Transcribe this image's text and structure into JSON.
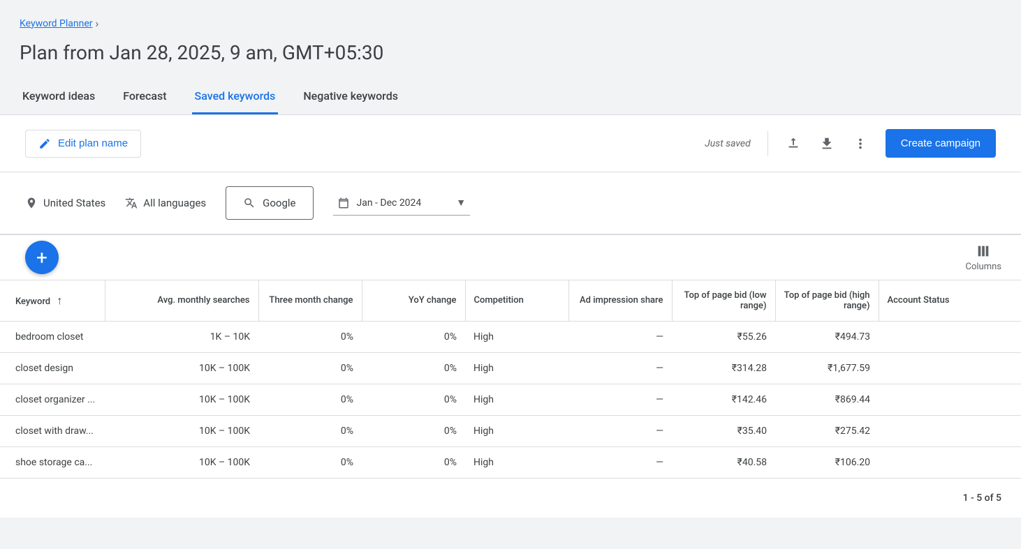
{
  "breadcrumb": {
    "parent": "Keyword Planner"
  },
  "page_title": "Plan from Jan 28, 2025, 9 am, GMT+05:30",
  "tabs": {
    "keyword_ideas": "Keyword ideas",
    "forecast": "Forecast",
    "saved_keywords": "Saved keywords",
    "negative_keywords": "Negative keywords"
  },
  "toolbar": {
    "edit_label": "Edit plan name",
    "saved_status": "Just saved",
    "create_campaign": "Create campaign"
  },
  "filters": {
    "location": "United States",
    "language": "All languages",
    "network": "Google",
    "date_range": "Jan - Dec 2024"
  },
  "columns_label": "Columns",
  "headers": {
    "keyword": "Keyword",
    "searches": "Avg. monthly searches",
    "three_month": "Three month change",
    "yoy": "YoY change",
    "competition": "Competition",
    "impression": "Ad impression share",
    "bid_low": "Top of page bid (low range)",
    "bid_high": "Top of page bid (high range)",
    "status": "Account Status"
  },
  "rows": [
    {
      "keyword": "bedroom closet",
      "searches": "1K – 10K",
      "tmc": "0%",
      "yoy": "0%",
      "comp": "High",
      "imp": "—",
      "low": "₹55.26",
      "high": "₹494.73",
      "status": ""
    },
    {
      "keyword": "closet design",
      "searches": "10K – 100K",
      "tmc": "0%",
      "yoy": "0%",
      "comp": "High",
      "imp": "—",
      "low": "₹314.28",
      "high": "₹1,677.59",
      "status": ""
    },
    {
      "keyword": "closet organizer ...",
      "searches": "10K – 100K",
      "tmc": "0%",
      "yoy": "0%",
      "comp": "High",
      "imp": "—",
      "low": "₹142.46",
      "high": "₹869.44",
      "status": ""
    },
    {
      "keyword": "closet with draw...",
      "searches": "10K – 100K",
      "tmc": "0%",
      "yoy": "0%",
      "comp": "High",
      "imp": "—",
      "low": "₹35.40",
      "high": "₹275.42",
      "status": ""
    },
    {
      "keyword": "shoe storage ca...",
      "searches": "10K – 100K",
      "tmc": "0%",
      "yoy": "0%",
      "comp": "High",
      "imp": "—",
      "low": "₹40.58",
      "high": "₹106.20",
      "status": ""
    }
  ],
  "pagination": "1 - 5 of 5"
}
